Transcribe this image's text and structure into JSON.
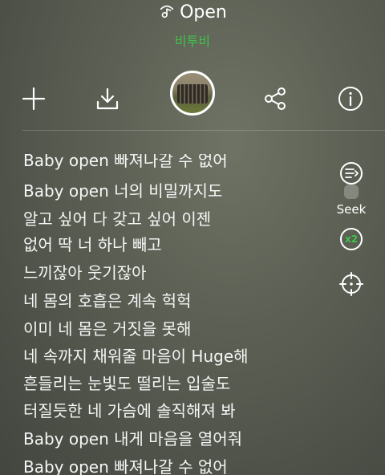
{
  "header": {
    "song_title": "Open",
    "artist": "비투비"
  },
  "toolbar": {
    "buttons": [
      {
        "icon": "plus-icon"
      },
      {
        "icon": "download-icon"
      },
      {
        "icon": "album-art"
      },
      {
        "icon": "share-icon"
      },
      {
        "icon": "info-icon"
      }
    ]
  },
  "side": {
    "seek_label": "Seek",
    "speed_label": "x2"
  },
  "lyrics": [
    "Baby open 빠져나갈 수 없어",
    "Baby open 너의 비밀까지도",
    "알고 싶어 다 갖고 싶어 이젠",
    "없어 딱 너 하나 빼고",
    "느끼잖아 웃기잖아",
    "네 몸의 호흡은 계속 헉헉",
    "이미 네 몸은 거짓을 못해",
    "네 속까지 채워줄 마음이 Huge해",
    "흔들리는 눈빛도 떨리는 입술도",
    "터질듯한 네 가슴에 솔직해져 봐",
    "Baby open 내게 마음을 열어줘",
    "Baby open 빠져나갈 수 없어"
  ],
  "colors": {
    "accent": "#3ec24a",
    "text": "#ffffff"
  }
}
